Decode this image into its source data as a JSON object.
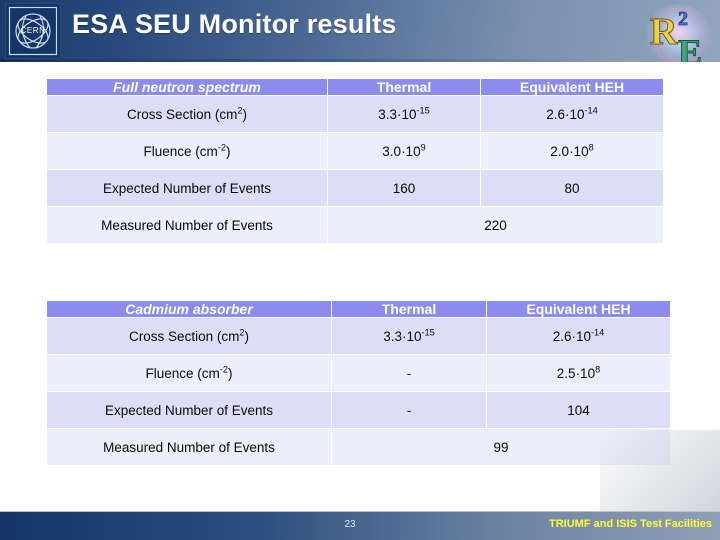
{
  "header": {
    "title": "ESA SEU Monitor results",
    "left_logo": "cern-logo",
    "right_logo": "r2e-logo",
    "left_logo_text": "CERN",
    "right_logo_text": "R2E"
  },
  "tables": [
    {
      "id": "table1",
      "columns": [
        "Full neutron spectrum",
        "Thermal",
        "Equivalent HEH"
      ],
      "rows": [
        {
          "label": "Cross Section (cm2)",
          "label_base": "Cross Section (cm",
          "label_sup": "2",
          "label_tail": ")",
          "thermal_mantissa": "3.3·10",
          "thermal_exp": "-15",
          "heh_mantissa": "2.6·10",
          "heh_exp": "-14",
          "span": false
        },
        {
          "label": "Fluence (cm-2)",
          "label_base": "Fluence (cm",
          "label_sup": "-2",
          "label_tail": ")",
          "thermal_mantissa": "3.0·10",
          "thermal_exp": "9",
          "heh_mantissa": "2.0·10",
          "heh_exp": "8",
          "span": false
        },
        {
          "label": "Expected Number of Events",
          "label_base": "Expected Number of Events",
          "label_sup": "",
          "label_tail": "",
          "thermal_mantissa": "160",
          "thermal_exp": "",
          "heh_mantissa": "80",
          "heh_exp": "",
          "span": false
        },
        {
          "label": "Measured Number of Events",
          "label_base": "Measured Number of Events",
          "label_sup": "",
          "label_tail": "",
          "span_value": "220",
          "span": true
        }
      ]
    },
    {
      "id": "table2",
      "columns": [
        "Cadmium absorber",
        "Thermal",
        "Equivalent HEH"
      ],
      "rows": [
        {
          "label": "Cross Section (cm2)",
          "label_base": "Cross Section (cm",
          "label_sup": "2",
          "label_tail": ")",
          "thermal_mantissa": "3.3·10",
          "thermal_exp": "-15",
          "heh_mantissa": "2.6·10",
          "heh_exp": "-14",
          "span": false
        },
        {
          "label": "Fluence (cm-2)",
          "label_base": "Fluence (cm",
          "label_sup": "-2",
          "label_tail": ")",
          "thermal_mantissa": "-",
          "thermal_exp": "",
          "heh_mantissa": "2.5·10",
          "heh_exp": "8",
          "span": false
        },
        {
          "label": "Expected Number of Events",
          "label_base": "Expected Number of Events",
          "label_sup": "",
          "label_tail": "",
          "thermal_mantissa": "-",
          "thermal_exp": "",
          "heh_mantissa": "104",
          "heh_exp": "",
          "span": false
        },
        {
          "label": "Measured Number of Events",
          "label_base": "Measured Number of Events",
          "label_sup": "",
          "label_tail": "",
          "span_value": "99",
          "span": true
        }
      ]
    }
  ],
  "footer": {
    "page_number": "23",
    "right_text": "TRIUMF and ISIS Test Facilities"
  },
  "colors": {
    "header_start": "#1d3a6b",
    "header_end": "#93a5bd",
    "table_header": "#8b8bf0",
    "row_shade": "#dcdef7",
    "row_light": "#eceefb",
    "footer_accent": "#ffff33"
  }
}
